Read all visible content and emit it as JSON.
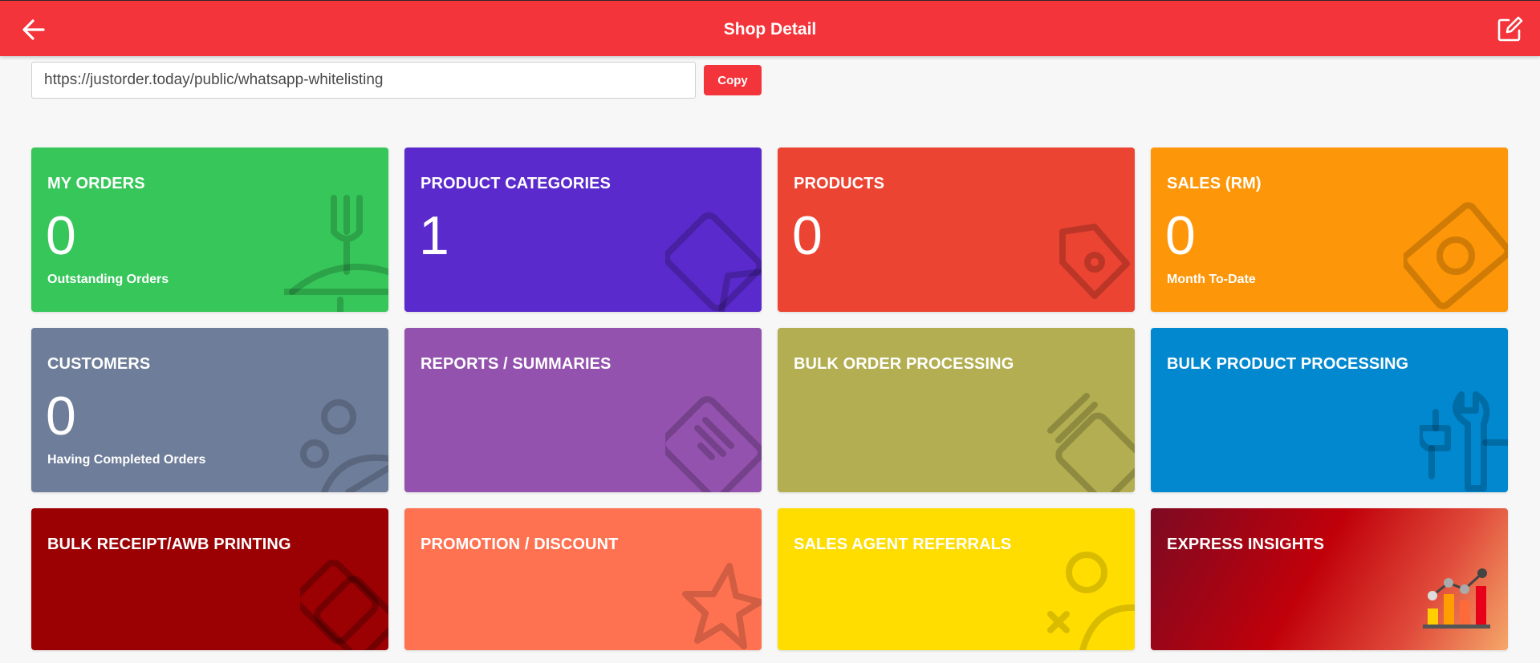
{
  "header": {
    "title": "Shop Detail",
    "back_icon": "arrow-left-icon",
    "edit_icon": "edit-square-icon"
  },
  "share": {
    "url": "https://justorder.today/public/whatsapp-whitelisting",
    "copy_label": "Copy"
  },
  "tiles": [
    {
      "title": "MY ORDERS",
      "value": "0",
      "sub": "Outstanding Orders",
      "color": "#36c65a",
      "icon": "fork-knife-plate-icon"
    },
    {
      "title": "PRODUCT CATEGORIES",
      "value": "1",
      "sub": "",
      "color": "#5a2acc",
      "icon": "tags-icon"
    },
    {
      "title": "PRODUCTS",
      "value": "0",
      "sub": "",
      "color": "#ec4433",
      "icon": "tag-icon"
    },
    {
      "title": "SALES (RM)",
      "value": "0",
      "sub": "Month To-Date",
      "color": "#fd9608",
      "icon": "money-icon"
    },
    {
      "title": "CUSTOMERS",
      "value": "0",
      "sub": "Having Completed Orders",
      "color": "#6e7d99",
      "icon": "users-icon"
    },
    {
      "title": "REPORTS / SUMMARIES",
      "value": "",
      "sub": "",
      "color": "#9352ae",
      "icon": "report-icon"
    },
    {
      "title": "BULK ORDER PROCESSING",
      "value": "",
      "sub": "",
      "color": "#b2ae51",
      "icon": "stack-icon"
    },
    {
      "title": "BULK PRODUCT PROCESSING",
      "value": "",
      "sub": "",
      "color": "#0188cf",
      "icon": "tools-icon"
    },
    {
      "title": "BULK RECEIPT/AWB PRINTING",
      "value": "",
      "sub": "",
      "color": "#9b0003",
      "icon": "print-stack-icon"
    },
    {
      "title": "PROMOTION / DISCOUNT",
      "value": "",
      "sub": "",
      "color": "#ff7251",
      "icon": "star-icon"
    },
    {
      "title": "SALES AGENT REFERRALS",
      "value": "",
      "sub": "",
      "color": "#ffdd00",
      "icon": "agent-referral-icon"
    },
    {
      "title": "EXPRESS INSIGHTS",
      "value": "",
      "sub": "",
      "color": "#c4000b",
      "icon": "bar-chart-icon"
    }
  ]
}
